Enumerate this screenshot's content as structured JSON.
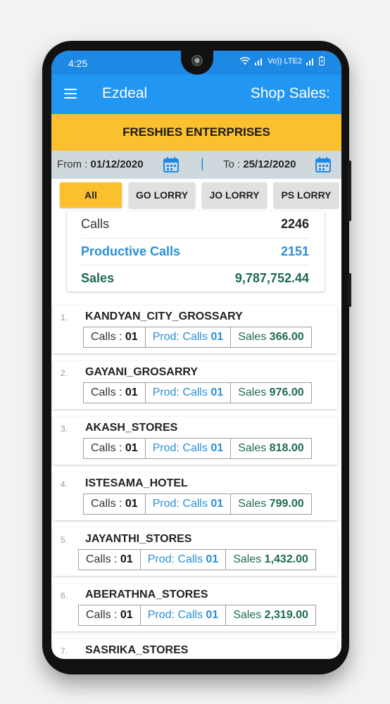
{
  "status_bar": {
    "time": "4:25",
    "network": "Vo)) LTE2"
  },
  "app_bar": {
    "app_name": "Ezdeal",
    "page_title": "Shop Sales:"
  },
  "company": "FRESHIES ENTERPRISES",
  "date_range": {
    "from_label": "From : ",
    "from_value": "01/12/2020",
    "separator": "|",
    "to_label": "To : ",
    "to_value": "25/12/2020"
  },
  "filters": [
    {
      "label": "All",
      "active": true
    },
    {
      "label": "GO LORRY",
      "active": false
    },
    {
      "label": "JO LORRY",
      "active": false
    },
    {
      "label": "PS LORRY",
      "active": false
    }
  ],
  "summary": {
    "calls_label": "Calls",
    "calls_value": "2246",
    "productive_label": "Productive Calls",
    "productive_value": "2151",
    "sales_label": "Sales",
    "sales_value": "9,787,752.44"
  },
  "stat_labels": {
    "calls": "Calls : ",
    "prod": "Prod: Calls ",
    "sales": "Sales "
  },
  "shops": [
    {
      "num": "1.",
      "name": "KANDYAN_CITY_GROSSARY",
      "calls": "01",
      "prod_calls": "01",
      "sales": "366.00"
    },
    {
      "num": "2.",
      "name": "GAYANI_GROSARRY",
      "calls": "01",
      "prod_calls": "01",
      "sales": "976.00"
    },
    {
      "num": "3.",
      "name": "AKASH_STORES",
      "calls": "01",
      "prod_calls": "01",
      "sales": "818.00"
    },
    {
      "num": "4.",
      "name": "ISTESAMA_HOTEL",
      "calls": "01",
      "prod_calls": "01",
      "sales": "799.00"
    },
    {
      "num": "5.",
      "name": "JAYANTHI_STORES",
      "calls": "01",
      "prod_calls": "01",
      "sales": "1,432.00"
    },
    {
      "num": "6.",
      "name": "ABERATHNA_STORES",
      "calls": "01",
      "prod_calls": "01",
      "sales": "2,319.00"
    },
    {
      "num": "7.",
      "name": "SASRIKA_STORES",
      "calls": "",
      "prod_calls": "",
      "sales": ""
    }
  ],
  "colors": {
    "app_bar": "#2196f3",
    "company_banner": "#fbc02d",
    "date_bar": "#cfd8dc",
    "productive": "#2a8fd6",
    "sales": "#1d6b4e"
  }
}
